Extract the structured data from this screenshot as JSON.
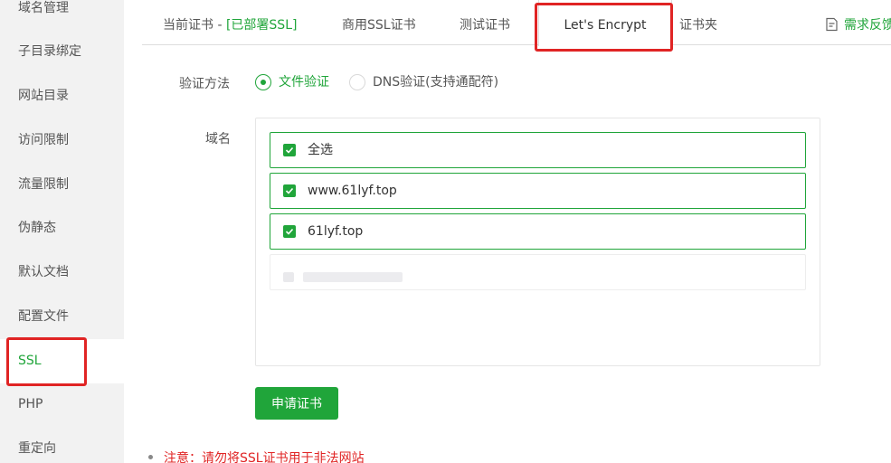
{
  "sidebar": {
    "items": [
      {
        "label": "域名管理",
        "active": false
      },
      {
        "label": "子目录绑定",
        "active": false
      },
      {
        "label": "网站目录",
        "active": false
      },
      {
        "label": "访问限制",
        "active": false
      },
      {
        "label": "流量限制",
        "active": false
      },
      {
        "label": "伪静态",
        "active": false
      },
      {
        "label": "默认文档",
        "active": false
      },
      {
        "label": "配置文件",
        "active": false
      },
      {
        "label": "SSL",
        "active": true
      },
      {
        "label": "PHP",
        "active": false
      },
      {
        "label": "重定向",
        "active": false
      }
    ]
  },
  "tabs": {
    "current_cert_prefix": "当前证书 - ",
    "current_cert_status": "[已部署SSL]",
    "commercial": "商用SSL证书",
    "test": "测试证书",
    "letsencrypt": "Let's Encrypt",
    "cert_folder": "证书夹",
    "active": "letsencrypt"
  },
  "feedback": {
    "label": "需求反馈",
    "icon": "edit-note-icon"
  },
  "form": {
    "verify_label": "验证方法",
    "verify_options": [
      {
        "label": "文件验证",
        "selected": true
      },
      {
        "label": "DNS验证(支持通配符)",
        "selected": false
      }
    ],
    "domain_label": "域名",
    "domains": [
      {
        "label": "全选",
        "checked": true
      },
      {
        "label": "www.61lyf.top",
        "checked": true
      },
      {
        "label": "61lyf.top",
        "checked": true
      }
    ],
    "apply_button": "申请证书"
  },
  "notice": "注意：请勿将SSL证书用于非法网站",
  "colors": {
    "accent": "#20a53a",
    "warning": "#e02424",
    "sidebar_bg": "#f2f2f2"
  }
}
